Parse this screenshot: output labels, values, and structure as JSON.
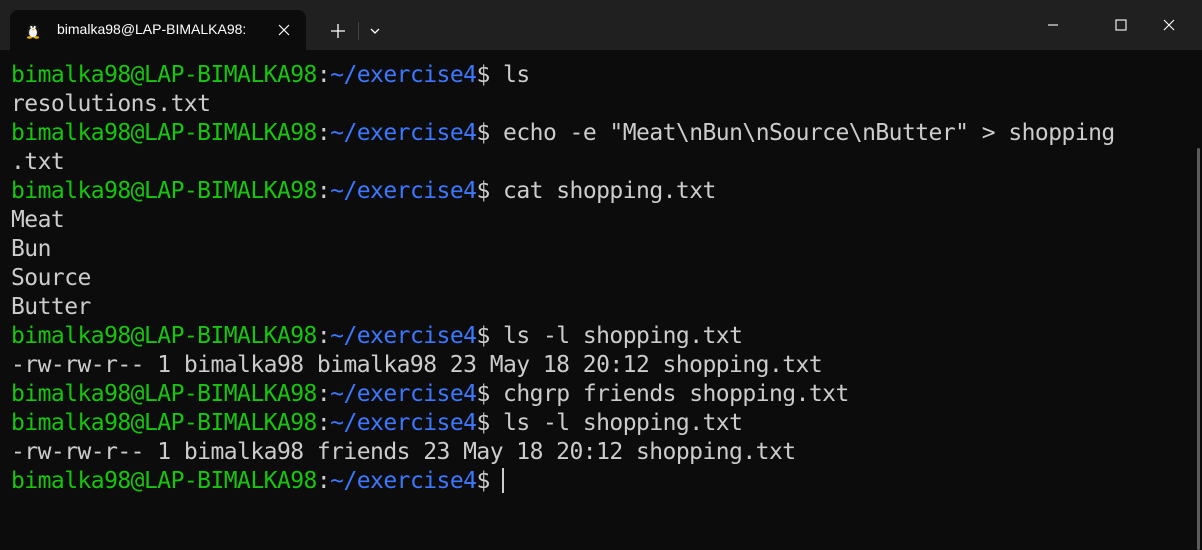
{
  "window": {
    "tab_title": "bimalka98@LAP-BIMALKA98:",
    "tab_icon": "linux-penguin-icon",
    "new_tab_icon": "plus-icon",
    "dropdown_icon": "chevron-down-icon"
  },
  "terminal": {
    "prompt": {
      "user": "bimalka98@LAP-BIMALKA98",
      "colon": ":",
      "path": "~/exercise4",
      "symbol": "$"
    },
    "lines": [
      {
        "type": "prompt",
        "command": " ls"
      },
      {
        "type": "output",
        "text": "resolutions.txt"
      },
      {
        "type": "prompt",
        "command": " echo -e \"Meat\\nBun\\nSource\\nButter\" > shopping"
      },
      {
        "type": "output",
        "text": ".txt"
      },
      {
        "type": "prompt",
        "command": " cat shopping.txt"
      },
      {
        "type": "output",
        "text": "Meat"
      },
      {
        "type": "output",
        "text": "Bun"
      },
      {
        "type": "output",
        "text": "Source"
      },
      {
        "type": "output",
        "text": "Butter"
      },
      {
        "type": "prompt",
        "command": " ls -l shopping.txt"
      },
      {
        "type": "output",
        "text": "-rw-rw-r-- 1 bimalka98 bimalka98 23 May 18 20:12 shopping.txt"
      },
      {
        "type": "prompt",
        "command": " chgrp friends shopping.txt"
      },
      {
        "type": "prompt",
        "command": " ls -l shopping.txt"
      },
      {
        "type": "output",
        "text": "-rw-rw-r-- 1 bimalka98 friends 23 May 18 20:12 shopping.txt"
      },
      {
        "type": "prompt",
        "command": " "
      }
    ]
  },
  "colors": {
    "user": "#16c60c",
    "path": "#3b78ff",
    "text": "#cccccc",
    "background": "#0c0c0c",
    "titlebar": "#202020"
  }
}
